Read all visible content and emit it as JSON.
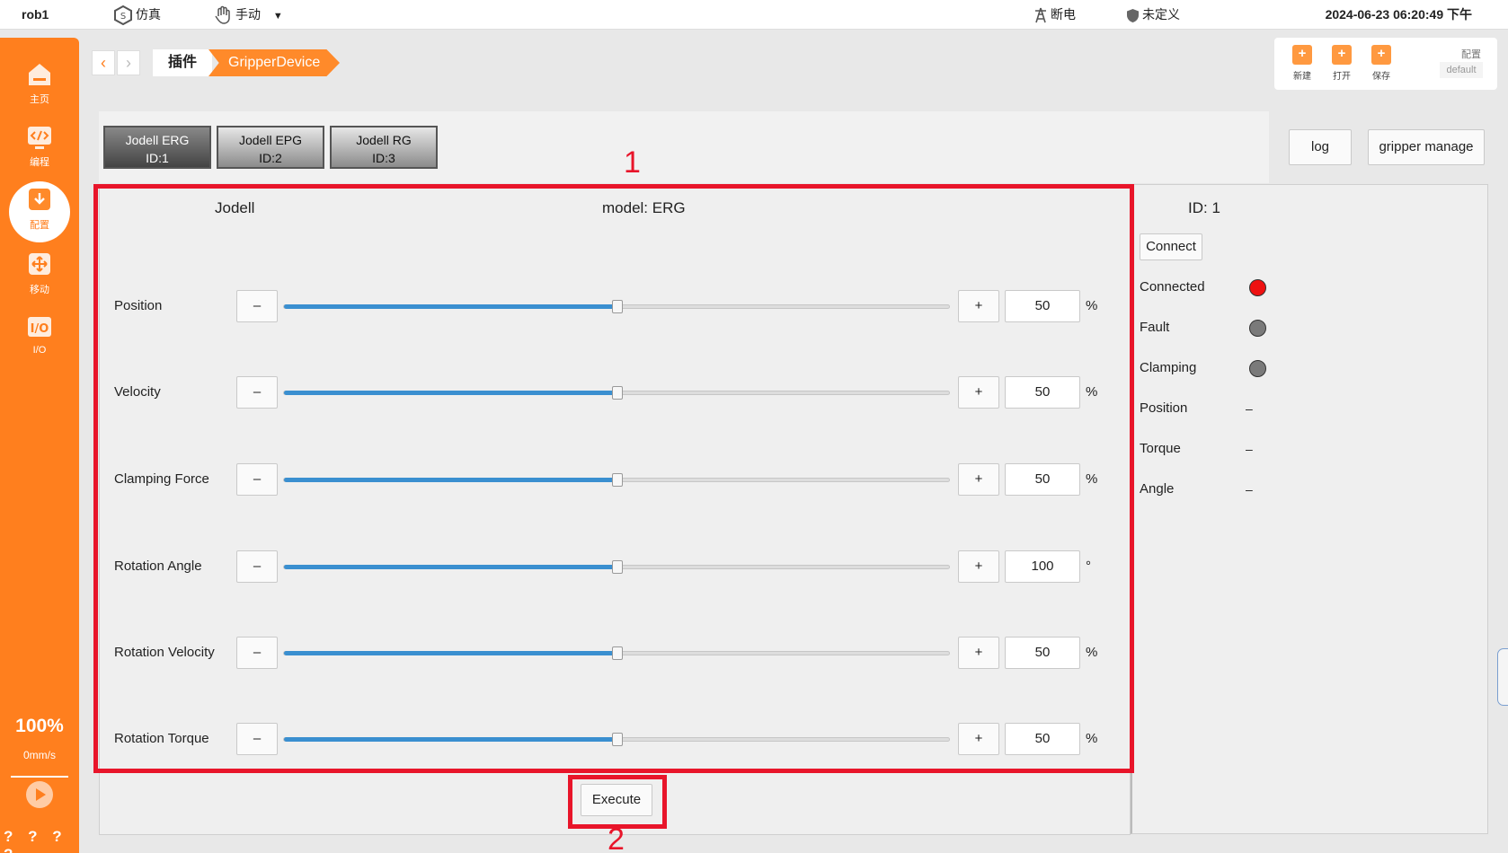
{
  "topbar": {
    "app_title": "rob1",
    "mode_sim": "仿真",
    "mode_manual": "手动",
    "power": "断电",
    "safety": "未定义",
    "datetime": "2024-06-23 06:20:49 下午"
  },
  "sidebar": {
    "items": [
      {
        "label": "主页",
        "icon": "home-icon"
      },
      {
        "label": "编程",
        "icon": "code-icon"
      },
      {
        "label": "配置",
        "icon": "config-icon"
      },
      {
        "label": "移动",
        "icon": "move-icon"
      },
      {
        "label": "I/O",
        "icon": "io-icon"
      }
    ],
    "speed_percent": "100%",
    "speed_mm": "0mm/s",
    "status_marks": "? ? ? ?"
  },
  "breadcrumb": {
    "back": "‹",
    "forward": "›",
    "crumb1": "插件",
    "crumb2": "GripperDevice"
  },
  "toolbar": {
    "new_label": "新建",
    "open_label": "打开",
    "save_label": "保存",
    "config_label": "配置",
    "config_value": "default"
  },
  "device_tabs": [
    {
      "line1": "Jodell ERG",
      "line2": "ID:1",
      "active": true
    },
    {
      "line1": "Jodell EPG",
      "line2": "ID:2",
      "active": false
    },
    {
      "line1": "Jodell RG",
      "line2": "ID:3",
      "active": false
    }
  ],
  "actions": {
    "log": "log",
    "gripper_manage": "gripper manage"
  },
  "panel": {
    "brand": "Jodell",
    "model": "model: ERG",
    "rows": [
      {
        "label": "Position",
        "value": "50",
        "unit": "%",
        "level_percent": 50
      },
      {
        "label": "Velocity",
        "value": "50",
        "unit": "%",
        "level_percent": 50
      },
      {
        "label": "Clamping Force",
        "value": "50",
        "unit": "%",
        "level_percent": 50
      },
      {
        "label": "Rotation Angle",
        "value": "100",
        "unit": "°",
        "level_percent": 50
      },
      {
        "label": "Rotation Velocity",
        "value": "50",
        "unit": "%",
        "level_percent": 50
      },
      {
        "label": "Rotation Torque",
        "value": "50",
        "unit": "%",
        "level_percent": 50
      }
    ],
    "minus": "–",
    "plus": "+",
    "execute": "Execute"
  },
  "status": {
    "id": "ID: 1",
    "connect": "Connect",
    "connected_label": "Connected",
    "fault_label": "Fault",
    "clamping_label": "Clamping",
    "position_label": "Position",
    "position_value": "–",
    "torque_label": "Torque",
    "torque_value": "–",
    "angle_label": "Angle",
    "angle_value": "–",
    "connected_color": "#ee1111",
    "inactive_color": "#7a7a7a"
  },
  "annotations": {
    "box1": "1",
    "box2": "2"
  }
}
